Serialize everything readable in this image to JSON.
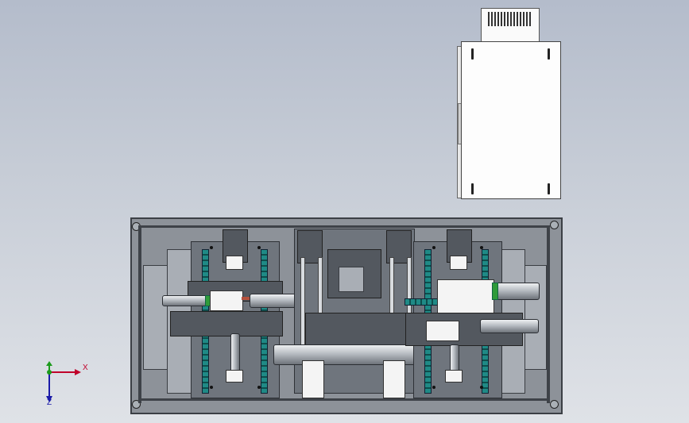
{
  "viewport": {
    "background_top": "#b4bccb",
    "background_bottom": "#dfe2e7"
  },
  "objects": {
    "cabinet": {
      "fill": "#fdfdfd",
      "outline": "#444444"
    },
    "machine": {
      "accent_rail": "#1f8a86",
      "accent_green": "#2f9b3a",
      "accent_red": "#b5503c"
    }
  },
  "triad": {
    "x_label": "X",
    "z_label": "Z",
    "x_color": "#c0002a",
    "y_color": "#1c9b1c",
    "z_color": "#1a1aa8"
  }
}
